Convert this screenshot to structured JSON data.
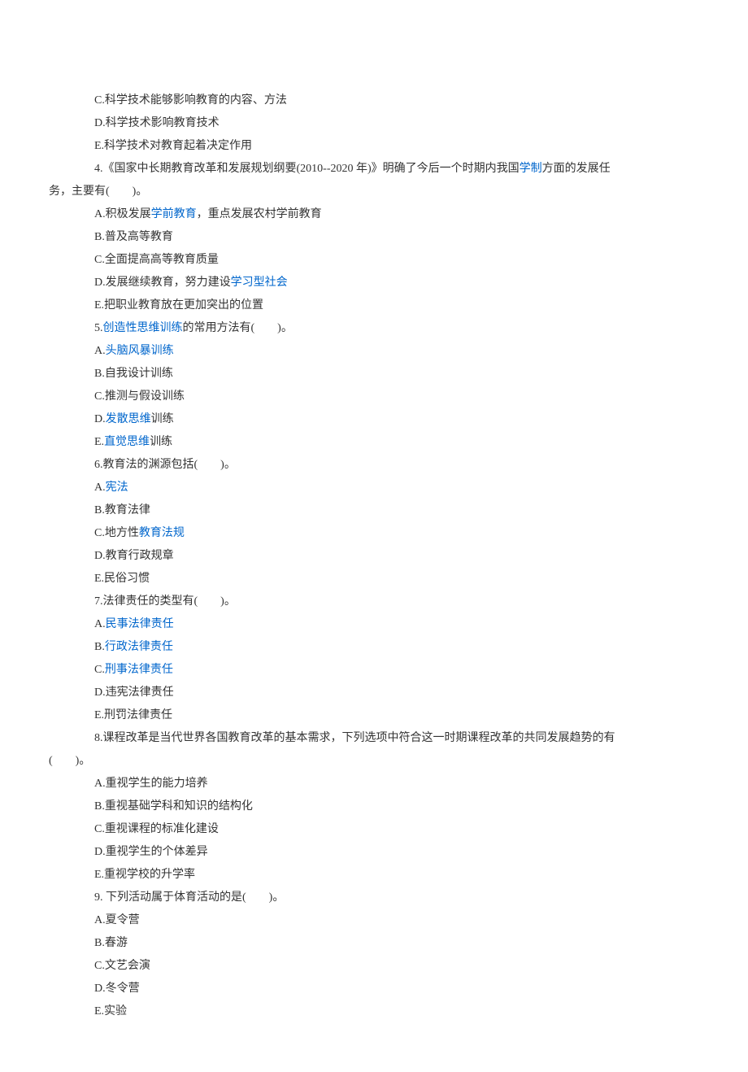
{
  "lines": [
    {
      "indent": true,
      "segs": [
        {
          "t": "C.科学技术能够影响教育的内容、方法"
        }
      ]
    },
    {
      "indent": true,
      "segs": [
        {
          "t": "D.科学技术影响教育技术"
        }
      ]
    },
    {
      "indent": true,
      "segs": [
        {
          "t": "E.科学技术对教育起着决定作用"
        }
      ]
    },
    {
      "indent": true,
      "segs": [
        {
          "t": "4.《国家中长期教育改革和发展规划纲要(2010--2020 年)》明确了今后一个时期内我国"
        },
        {
          "t": "学制",
          "link": true
        },
        {
          "t": "方面的发展任"
        }
      ]
    },
    {
      "indent": false,
      "segs": [
        {
          "t": "务，主要有(　　)。"
        }
      ]
    },
    {
      "indent": true,
      "segs": [
        {
          "t": "A.积极发展"
        },
        {
          "t": "学前教育",
          "link": true
        },
        {
          "t": "，重点发展农村学前教育"
        }
      ]
    },
    {
      "indent": true,
      "segs": [
        {
          "t": "B.普及高等教育"
        }
      ]
    },
    {
      "indent": true,
      "segs": [
        {
          "t": "C.全面提高高等教育质量"
        }
      ]
    },
    {
      "indent": true,
      "segs": [
        {
          "t": "D.发展继续教育，努力建设"
        },
        {
          "t": "学习型社会",
          "link": true
        }
      ]
    },
    {
      "indent": true,
      "segs": [
        {
          "t": "E.把职业教育放在更加突出的位置"
        }
      ]
    },
    {
      "indent": true,
      "segs": [
        {
          "t": "5."
        },
        {
          "t": "创造性思维训练",
          "link": true
        },
        {
          "t": "的常用方法有(　　)。"
        }
      ]
    },
    {
      "indent": true,
      "segs": [
        {
          "t": "A."
        },
        {
          "t": "头脑风暴训练",
          "link": true
        }
      ]
    },
    {
      "indent": true,
      "segs": [
        {
          "t": "B.自我设计训练"
        }
      ]
    },
    {
      "indent": true,
      "segs": [
        {
          "t": "C.推测与假设训练"
        }
      ]
    },
    {
      "indent": true,
      "segs": [
        {
          "t": "D."
        },
        {
          "t": "发散思维",
          "link": true
        },
        {
          "t": "训练"
        }
      ]
    },
    {
      "indent": true,
      "segs": [
        {
          "t": "E."
        },
        {
          "t": "直觉思维",
          "link": true
        },
        {
          "t": "训练"
        }
      ]
    },
    {
      "indent": true,
      "segs": [
        {
          "t": "6.教育法的渊源包括(　　)。"
        }
      ]
    },
    {
      "indent": true,
      "segs": [
        {
          "t": "A."
        },
        {
          "t": "宪法",
          "link": true
        }
      ]
    },
    {
      "indent": true,
      "segs": [
        {
          "t": "B.教育法律"
        }
      ]
    },
    {
      "indent": true,
      "segs": [
        {
          "t": "C.地方性"
        },
        {
          "t": "教育法规",
          "link": true
        }
      ]
    },
    {
      "indent": true,
      "segs": [
        {
          "t": "D.教育行政规章"
        }
      ]
    },
    {
      "indent": true,
      "segs": [
        {
          "t": "E.民俗习惯"
        }
      ]
    },
    {
      "indent": true,
      "segs": [
        {
          "t": "7.法律责任的类型有(　　)。"
        }
      ]
    },
    {
      "indent": true,
      "segs": [
        {
          "t": "A."
        },
        {
          "t": "民事法律责任",
          "link": true
        }
      ]
    },
    {
      "indent": true,
      "segs": [
        {
          "t": "B."
        },
        {
          "t": "行政法律责任",
          "link": true
        }
      ]
    },
    {
      "indent": true,
      "segs": [
        {
          "t": "C."
        },
        {
          "t": "刑事法律责任",
          "link": true
        }
      ]
    },
    {
      "indent": true,
      "segs": [
        {
          "t": "D.违宪法律责任"
        }
      ]
    },
    {
      "indent": true,
      "segs": [
        {
          "t": "E.刑罚法律责任"
        }
      ]
    },
    {
      "indent": true,
      "segs": [
        {
          "t": "8.课程改革是当代世界各国教育改革的基本需求，下列选项中符合这一时期课程改革的共同发展趋势的有"
        }
      ]
    },
    {
      "indent": false,
      "segs": [
        {
          "t": "(　　)。"
        }
      ]
    },
    {
      "indent": true,
      "segs": [
        {
          "t": "A.重视学生的能力培养"
        }
      ]
    },
    {
      "indent": true,
      "segs": [
        {
          "t": "B.重视基础学科和知识的结构化"
        }
      ]
    },
    {
      "indent": true,
      "segs": [
        {
          "t": "C.重视课程的标准化建设"
        }
      ]
    },
    {
      "indent": true,
      "segs": [
        {
          "t": "D.重视学生的个体差异"
        }
      ]
    },
    {
      "indent": true,
      "segs": [
        {
          "t": "E.重视学校的升学率"
        }
      ]
    },
    {
      "indent": true,
      "segs": [
        {
          "t": "9. 下列活动属于体育活动的是(　　)。"
        }
      ]
    },
    {
      "indent": true,
      "segs": [
        {
          "t": "A.夏令营"
        }
      ]
    },
    {
      "indent": true,
      "segs": [
        {
          "t": "B.春游"
        }
      ]
    },
    {
      "indent": true,
      "segs": [
        {
          "t": "C.文艺会演"
        }
      ]
    },
    {
      "indent": true,
      "segs": [
        {
          "t": "D.冬令营"
        }
      ]
    },
    {
      "indent": true,
      "segs": [
        {
          "t": "E.实验"
        }
      ]
    }
  ]
}
